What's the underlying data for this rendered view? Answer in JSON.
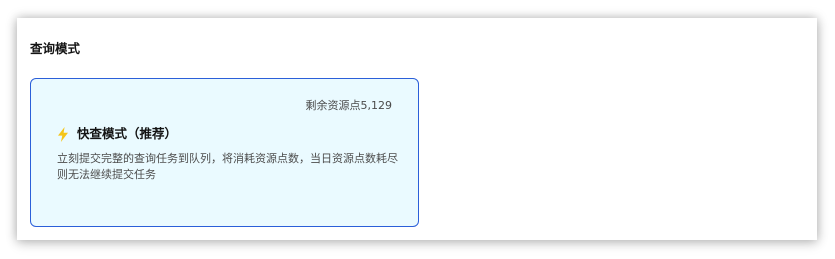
{
  "section": {
    "title": "查询模式"
  },
  "mode_card": {
    "remaining_label": "剩余资源点5,129",
    "icon": "lightning-bolt-icon",
    "title": "快查模式（推荐）",
    "description": "立刻提交完整的查询任务到队列，将消耗资源点数，当日资源点数耗尽则无法继续提交任务",
    "selected": true
  },
  "colors": {
    "card_border": "#2b5fd9",
    "card_background": "#eafaff",
    "bolt_icon": "#f5c518"
  }
}
